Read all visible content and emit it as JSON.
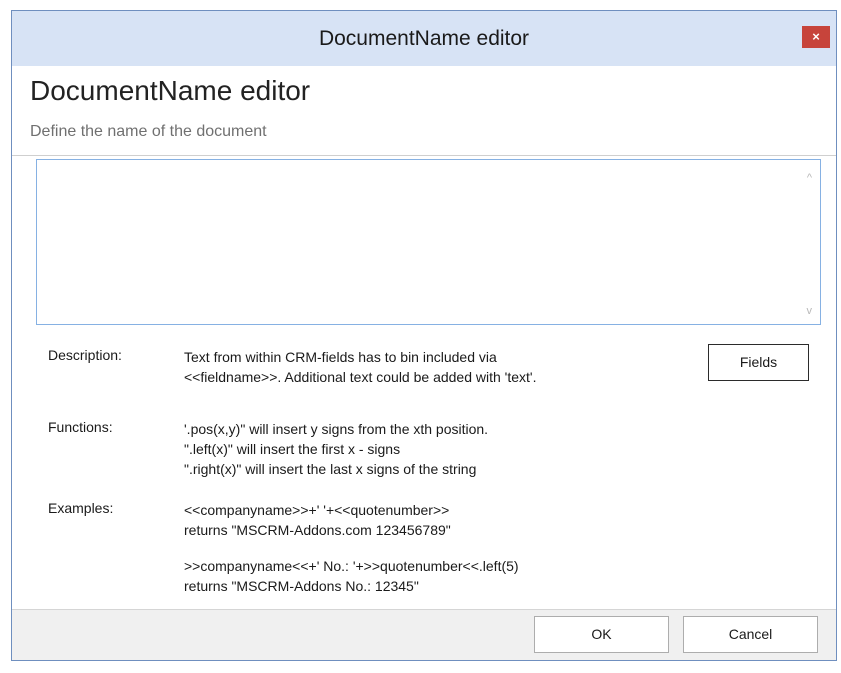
{
  "window": {
    "title": "DocumentName editor",
    "close_label": "×"
  },
  "header": {
    "title": "DocumentName editor",
    "subtitle": "Define the name of the document"
  },
  "editor": {
    "value": "",
    "scroll_up": "^",
    "scroll_down": "v"
  },
  "description": {
    "label": "Description:",
    "lines": [
      "Text from within CRM-fields has to bin included via",
      "<<fieldname>>. Additional text could be added with 'text'."
    ]
  },
  "fields_button": "Fields",
  "functions": {
    "label": "Functions:",
    "lines": [
      "'.pos(x,y)\" will insert y signs from the xth position.",
      "\".left(x)\" will insert the first x - signs",
      "\".right(x)\" will insert the last x signs of the string"
    ]
  },
  "examples": {
    "label": "Examples:",
    "example1": [
      "<<companyname>>+' '+<<quotenumber>>",
      "returns \"MSCRM-Addons.com 123456789\""
    ],
    "example2": [
      ">>companyname<<+' No.: '+>>quotenumber<<.left(5)",
      "returns \"MSCRM-Addons No.: 12345\""
    ]
  },
  "footer": {
    "ok": "OK",
    "cancel": "Cancel"
  },
  "colors": {
    "titlebar": "#d7e3f5",
    "close_button": "#c7443b",
    "editor_border": "#86b1e3"
  }
}
